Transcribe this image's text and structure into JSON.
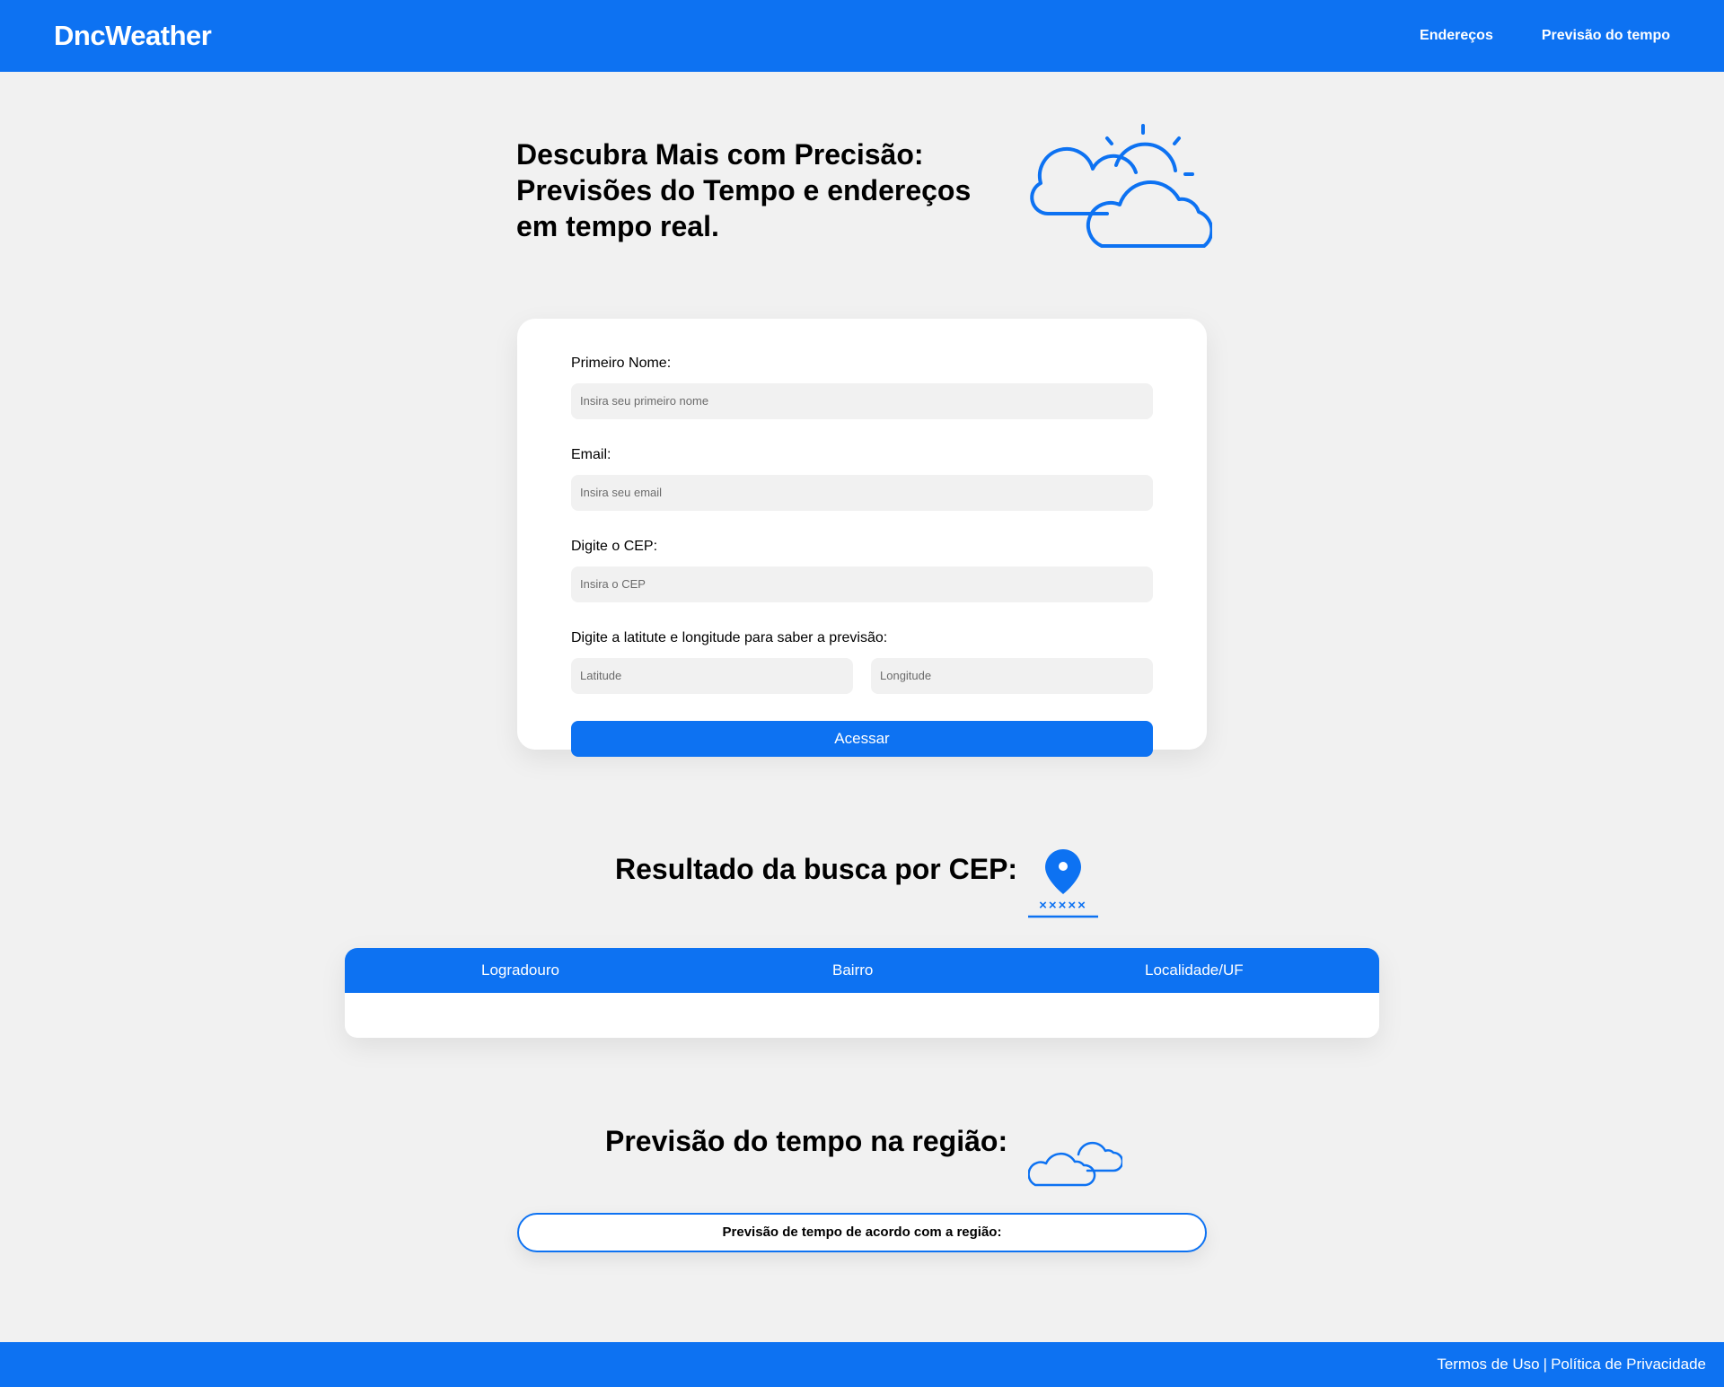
{
  "header": {
    "logo": "DncWeather",
    "nav": [
      {
        "label": "Endereços"
      },
      {
        "label": "Previsão do tempo"
      }
    ]
  },
  "hero": {
    "title": "Descubra Mais com Precisão: Previsões do Tempo e endereços em tempo real.",
    "icon": "sun-cloud-icon"
  },
  "form": {
    "first_name": {
      "label": "Primeiro Nome:",
      "placeholder": "Insira seu primeiro nome",
      "value": ""
    },
    "email": {
      "label": "Email:",
      "placeholder": "Insira seu email",
      "value": ""
    },
    "cep": {
      "label": "Digite o CEP:",
      "placeholder": "Insira o CEP",
      "value": ""
    },
    "coords": {
      "label": "Digite a latitute e longitude para saber a previsão:",
      "latitude_placeholder": "Latitude",
      "longitude_placeholder": "Longitude"
    },
    "submit_label": "Acessar"
  },
  "cep_result": {
    "title": "Resultado da busca por CEP:",
    "icon": "map-pin-icon",
    "icon_caption": "×××××",
    "columns": [
      "Logradouro",
      "Bairro",
      "Localidade/UF"
    ],
    "rows": []
  },
  "weather": {
    "title": "Previsão do tempo na região:",
    "icon": "clouds-icon",
    "box_text": "Previsão de tempo de acordo com a região:"
  },
  "footer": {
    "terms": "Termos de Uso",
    "separator": "|",
    "privacy": "Política de Privacidade"
  },
  "colors": {
    "primary": "#0d72f2",
    "background": "#f1f1f1",
    "input_bg": "#f1f1f1"
  }
}
